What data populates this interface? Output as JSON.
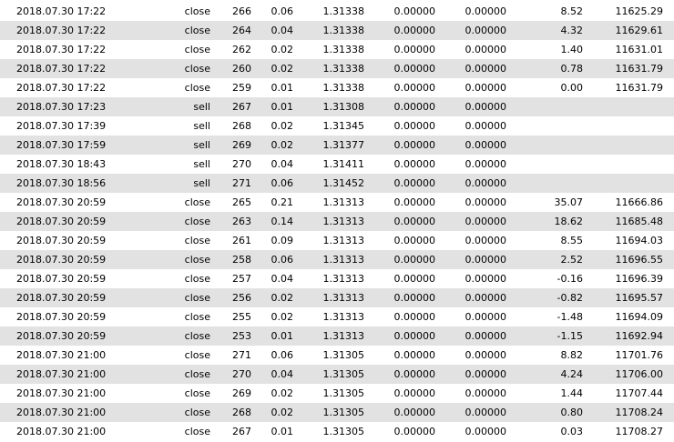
{
  "colors": {
    "row_shade": "#e2e2e2",
    "text": "#000000"
  },
  "rows": [
    [
      "2018.07.30 17:22",
      "close",
      "266",
      "0.06",
      "1.31338",
      "0.00000",
      "0.00000",
      "8.52",
      "11625.29"
    ],
    [
      "2018.07.30 17:22",
      "close",
      "264",
      "0.04",
      "1.31338",
      "0.00000",
      "0.00000",
      "4.32",
      "11629.61"
    ],
    [
      "2018.07.30 17:22",
      "close",
      "262",
      "0.02",
      "1.31338",
      "0.00000",
      "0.00000",
      "1.40",
      "11631.01"
    ],
    [
      "2018.07.30 17:22",
      "close",
      "260",
      "0.02",
      "1.31338",
      "0.00000",
      "0.00000",
      "0.78",
      "11631.79"
    ],
    [
      "2018.07.30 17:22",
      "close",
      "259",
      "0.01",
      "1.31338",
      "0.00000",
      "0.00000",
      "0.00",
      "11631.79"
    ],
    [
      "2018.07.30 17:23",
      "sell",
      "267",
      "0.01",
      "1.31308",
      "0.00000",
      "0.00000",
      "",
      ""
    ],
    [
      "2018.07.30 17:39",
      "sell",
      "268",
      "0.02",
      "1.31345",
      "0.00000",
      "0.00000",
      "",
      ""
    ],
    [
      "2018.07.30 17:59",
      "sell",
      "269",
      "0.02",
      "1.31377",
      "0.00000",
      "0.00000",
      "",
      ""
    ],
    [
      "2018.07.30 18:43",
      "sell",
      "270",
      "0.04",
      "1.31411",
      "0.00000",
      "0.00000",
      "",
      ""
    ],
    [
      "2018.07.30 18:56",
      "sell",
      "271",
      "0.06",
      "1.31452",
      "0.00000",
      "0.00000",
      "",
      ""
    ],
    [
      "2018.07.30 20:59",
      "close",
      "265",
      "0.21",
      "1.31313",
      "0.00000",
      "0.00000",
      "35.07",
      "11666.86"
    ],
    [
      "2018.07.30 20:59",
      "close",
      "263",
      "0.14",
      "1.31313",
      "0.00000",
      "0.00000",
      "18.62",
      "11685.48"
    ],
    [
      "2018.07.30 20:59",
      "close",
      "261",
      "0.09",
      "1.31313",
      "0.00000",
      "0.00000",
      "8.55",
      "11694.03"
    ],
    [
      "2018.07.30 20:59",
      "close",
      "258",
      "0.06",
      "1.31313",
      "0.00000",
      "0.00000",
      "2.52",
      "11696.55"
    ],
    [
      "2018.07.30 20:59",
      "close",
      "257",
      "0.04",
      "1.31313",
      "0.00000",
      "0.00000",
      "-0.16",
      "11696.39"
    ],
    [
      "2018.07.30 20:59",
      "close",
      "256",
      "0.02",
      "1.31313",
      "0.00000",
      "0.00000",
      "-0.82",
      "11695.57"
    ],
    [
      "2018.07.30 20:59",
      "close",
      "255",
      "0.02",
      "1.31313",
      "0.00000",
      "0.00000",
      "-1.48",
      "11694.09"
    ],
    [
      "2018.07.30 20:59",
      "close",
      "253",
      "0.01",
      "1.31313",
      "0.00000",
      "0.00000",
      "-1.15",
      "11692.94"
    ],
    [
      "2018.07.30 21:00",
      "close",
      "271",
      "0.06",
      "1.31305",
      "0.00000",
      "0.00000",
      "8.82",
      "11701.76"
    ],
    [
      "2018.07.30 21:00",
      "close",
      "270",
      "0.04",
      "1.31305",
      "0.00000",
      "0.00000",
      "4.24",
      "11706.00"
    ],
    [
      "2018.07.30 21:00",
      "close",
      "269",
      "0.02",
      "1.31305",
      "0.00000",
      "0.00000",
      "1.44",
      "11707.44"
    ],
    [
      "2018.07.30 21:00",
      "close",
      "268",
      "0.02",
      "1.31305",
      "0.00000",
      "0.00000",
      "0.80",
      "11708.24"
    ],
    [
      "2018.07.30 21:00",
      "close",
      "267",
      "0.01",
      "1.31305",
      "0.00000",
      "0.00000",
      "0.03",
      "11708.27"
    ]
  ]
}
